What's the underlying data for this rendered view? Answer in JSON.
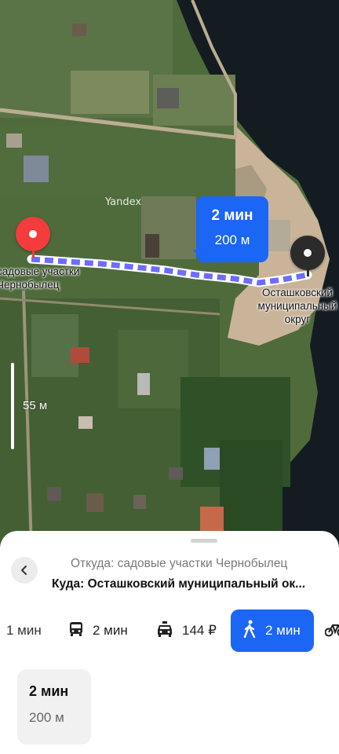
{
  "map": {
    "watermark": "Yandex",
    "scale_label": "55 м",
    "origin_label": "садовые участки Чернобылец",
    "destination_label": "Осташковский муниципальный округ",
    "route_bubble": {
      "time": "2 мин",
      "distance": "200 м"
    },
    "colors": {
      "route": "#6d6cff",
      "bubble": "#1b66f5",
      "origin_pin": "#f43c3c",
      "destination_pin": "#2b2b2b"
    }
  },
  "sheet": {
    "from_text": "Откуда: садовые участки Чернобылец",
    "to_text": "Куда: Осташковский муниципальный ок...",
    "modes": [
      {
        "id": "car-partial",
        "icon": "car-icon",
        "label": "1 мин",
        "active": false
      },
      {
        "id": "transit",
        "icon": "bus-icon",
        "label": "2 мин",
        "active": false
      },
      {
        "id": "taxi",
        "icon": "taxi-icon",
        "label": "144 ₽",
        "active": false
      },
      {
        "id": "walk",
        "icon": "walking-icon",
        "label": "2 мин",
        "active": true
      },
      {
        "id": "bike",
        "icon": "bicycle-icon",
        "label": "",
        "active": false
      }
    ],
    "summary_card": {
      "time": "2 мин",
      "distance": "200 м"
    }
  }
}
